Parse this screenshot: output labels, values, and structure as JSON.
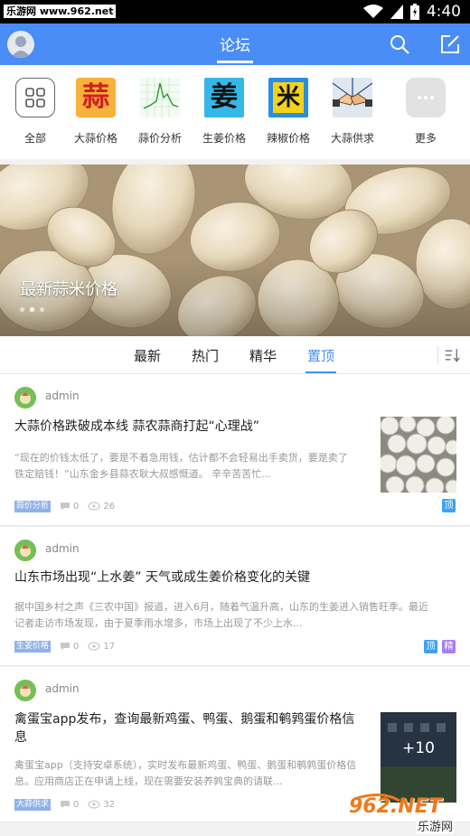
{
  "status_bar": {
    "watermark": "乐游网 www.962.net",
    "time": "4:40"
  },
  "header": {
    "title": "论坛"
  },
  "categories": [
    {
      "label": "全部",
      "icon": "grid-icon"
    },
    {
      "label": "大蒜价格",
      "icon": "garlic-char-icon",
      "glyph": "蒜"
    },
    {
      "label": "蒜价分析",
      "icon": "price-chart-icon"
    },
    {
      "label": "生姜价格",
      "icon": "ginger-char-icon",
      "glyph": "姜"
    },
    {
      "label": "辣椒价格",
      "icon": "rice-char-icon",
      "glyph": "米"
    },
    {
      "label": "大蒜供求",
      "icon": "handshake-icon"
    },
    {
      "label": "更多",
      "icon": "more-icon"
    }
  ],
  "banner": {
    "caption": "最新蒜米价格",
    "slide_count": 3,
    "active_slide": 2
  },
  "tabs": [
    {
      "label": "最新",
      "active": false
    },
    {
      "label": "热门",
      "active": false
    },
    {
      "label": "精华",
      "active": false
    },
    {
      "label": "置顶",
      "active": true
    }
  ],
  "posts": [
    {
      "author": "admin",
      "title": "大蒜价格跌破成本线 蒜农蒜商打起“心理战”",
      "desc": "“现在的价钱太低了，要是不着急用钱，估计都不会轻易出手卖货，要是卖了铁定赔钱！”山东金乡县蒜农耿大叔感慨道。       辛辛苦苦忙...",
      "tag": "蒜价分析",
      "comments": "0",
      "views": "26",
      "badges": [
        "顶"
      ]
    },
    {
      "author": "admin",
      "title": "山东市场出现“上水姜” 天气或成生姜价格变化的关键",
      "desc": "据中国乡村之声《三农中国》报道，进入6月，随着气温升高，山东的生姜进入销售旺季。最近记者走访市场发现，由于夏季雨水增多，市场上出现了不少上水...",
      "tag": "生姜价格",
      "comments": "0",
      "views": "17",
      "badges": [
        "顶",
        "精"
      ]
    },
    {
      "author": "admin",
      "title": "禽蛋宝app发布，查询最新鸡蛋、鸭蛋、鹅蛋和鹌鹑蛋价格信息",
      "desc": "禽蛋宝app（支持安卓系统），实时发布最新鸡蛋、鸭蛋、鹅蛋和鹌鹑蛋价格信息。应用商店正在申请上线，现在需要安装养鹑宝典的请联...",
      "tag": "大蒜供求",
      "comments": "0",
      "views": "32",
      "image_count": "+10"
    }
  ],
  "watermark": {
    "brand": "962.NET",
    "text": "乐游网"
  },
  "colors": {
    "accent": "#4a8df6",
    "pin_badge": "#3da2f0",
    "essence_badge": "#a77ef0"
  }
}
